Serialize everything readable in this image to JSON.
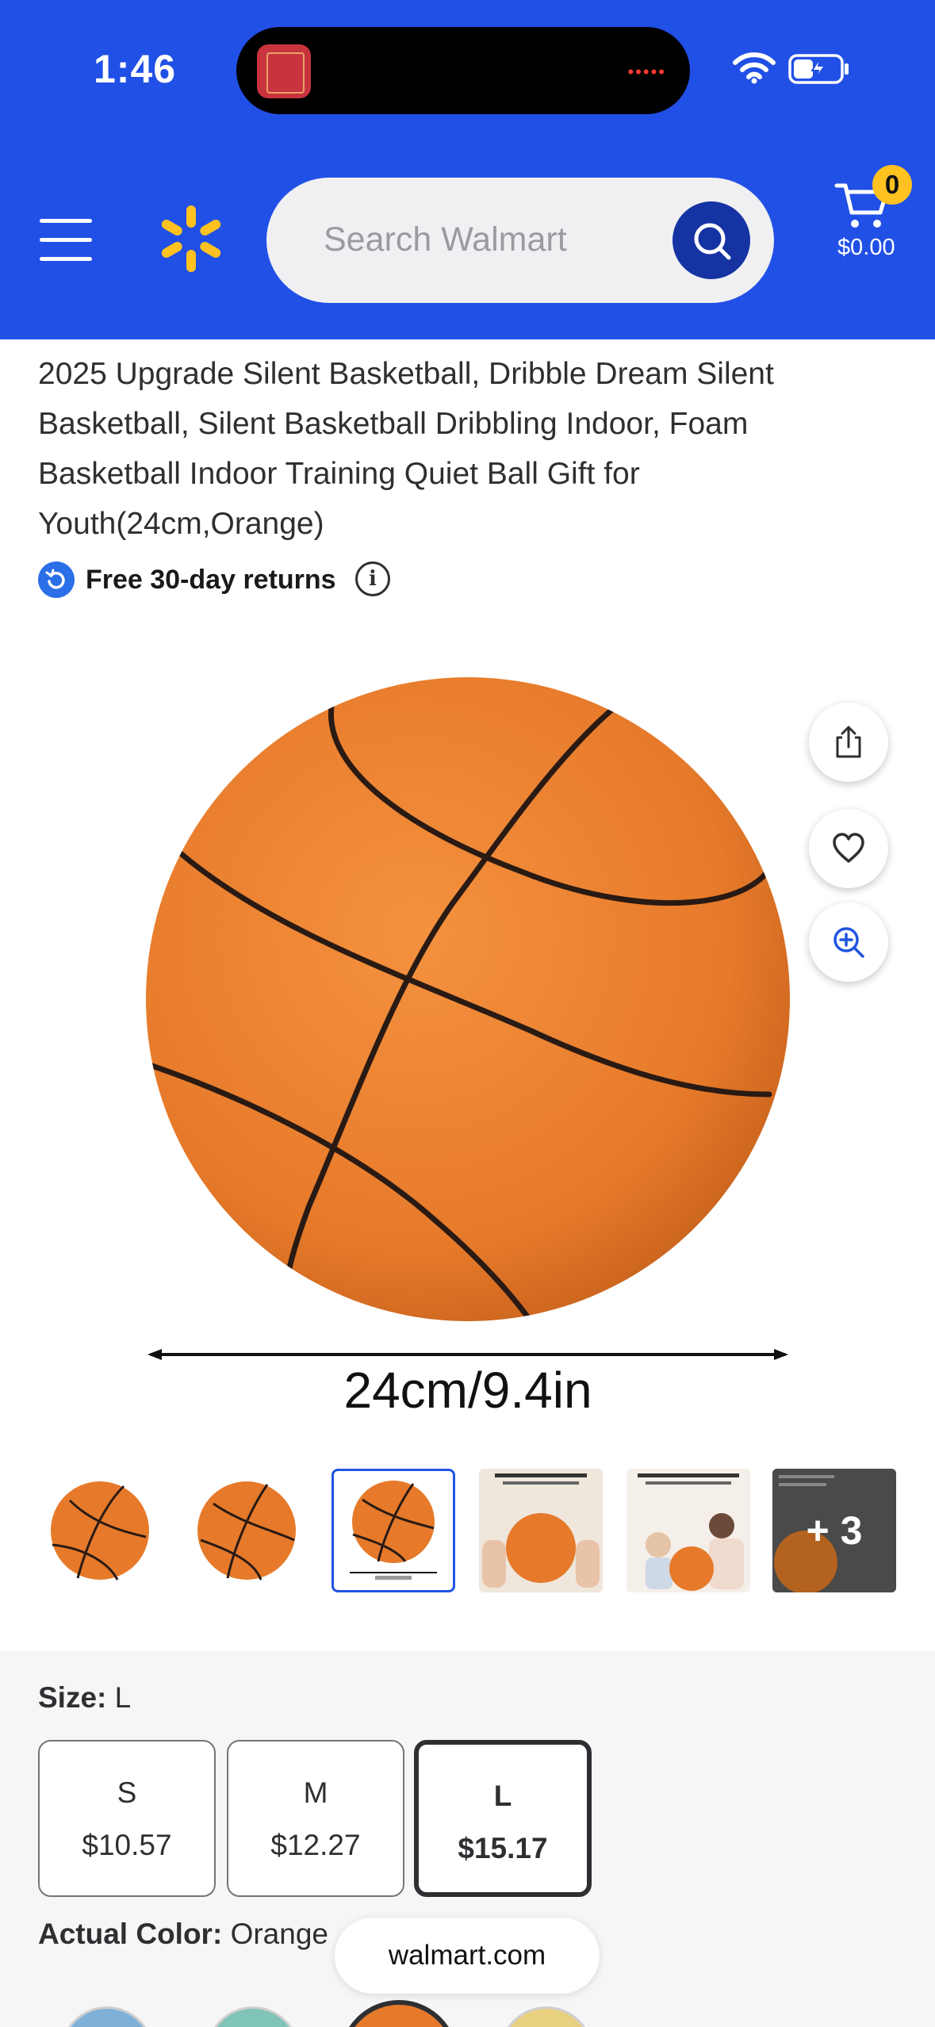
{
  "status_bar": {
    "time": "1:46"
  },
  "header": {
    "search_placeholder": "Search Walmart",
    "cart_count": "0",
    "cart_total": "$0.00",
    "brand_color": "#2150e6",
    "spark_color": "#ffc220"
  },
  "product": {
    "title": "2025 Upgrade Silent Basketball, Dribble Dream Silent Basketball, Silent Basketball Dribbling Indoor, Foam Basketball Indoor Training Quiet Ball Gift for Youth(24cm,Orange)",
    "returns": "Free 30-day returns",
    "info_glyph": "i",
    "image_caption": "24cm/9.4in",
    "more_thumbnails": "+ 3",
    "selected_thumbnail": 3
  },
  "icons": {
    "share": "share-icon",
    "favorite": "heart-icon",
    "zoom": "zoom-in-icon",
    "menu": "hamburger-menu-icon",
    "search": "search-icon",
    "cart": "cart-icon"
  },
  "options": {
    "size_label": "Size:",
    "size_value": "L",
    "sizes": [
      {
        "name": "S",
        "price": "$10.57"
      },
      {
        "name": "M",
        "price": "$12.27"
      },
      {
        "name": "L",
        "price": "$15.17",
        "selected": true
      }
    ],
    "color_label": "Actual Color:",
    "color_value": "Orange"
  },
  "browser": {
    "url": "walmart.com"
  }
}
